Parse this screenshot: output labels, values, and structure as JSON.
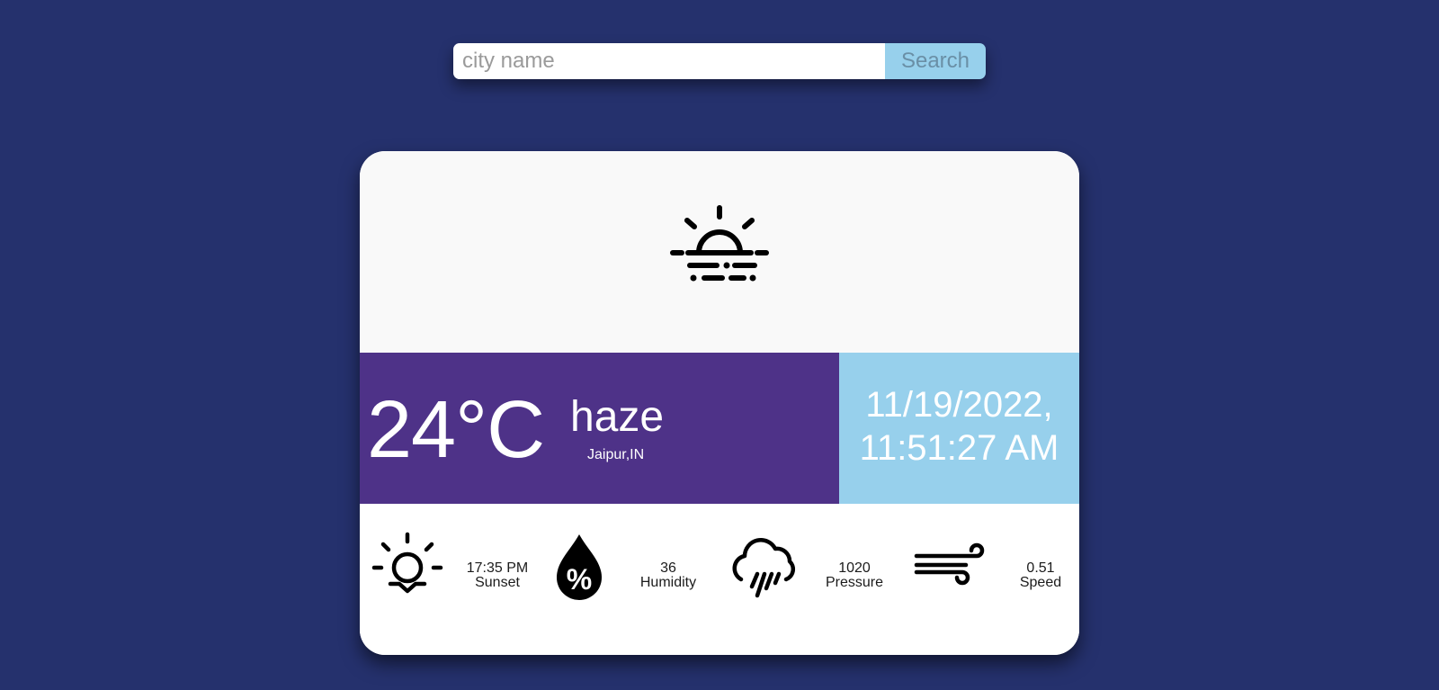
{
  "search": {
    "placeholder": "city name",
    "button_label": "Search",
    "value": ""
  },
  "weather": {
    "main_icon": "sunrise-haze-icon",
    "temperature": "24°C",
    "condition": "haze",
    "location": "Jaipur,IN",
    "date": "11/19/2022,",
    "time": "11:51:27 AM"
  },
  "stats": [
    {
      "icon": "sunset-icon",
      "value": "17:35 PM",
      "label": "Sunset"
    },
    {
      "icon": "humidity-icon",
      "value": "36",
      "label": "Humidity"
    },
    {
      "icon": "rain-cloud-icon",
      "value": "1020",
      "label": "Pressure"
    },
    {
      "icon": "wind-icon",
      "value": "0.51",
      "label": "Speed"
    }
  ],
  "colors": {
    "background": "#25316d",
    "temp_panel": "#4e3288",
    "date_panel": "#97d0ec",
    "search_button": "#97d0ec",
    "card": "#f9f9f9"
  }
}
